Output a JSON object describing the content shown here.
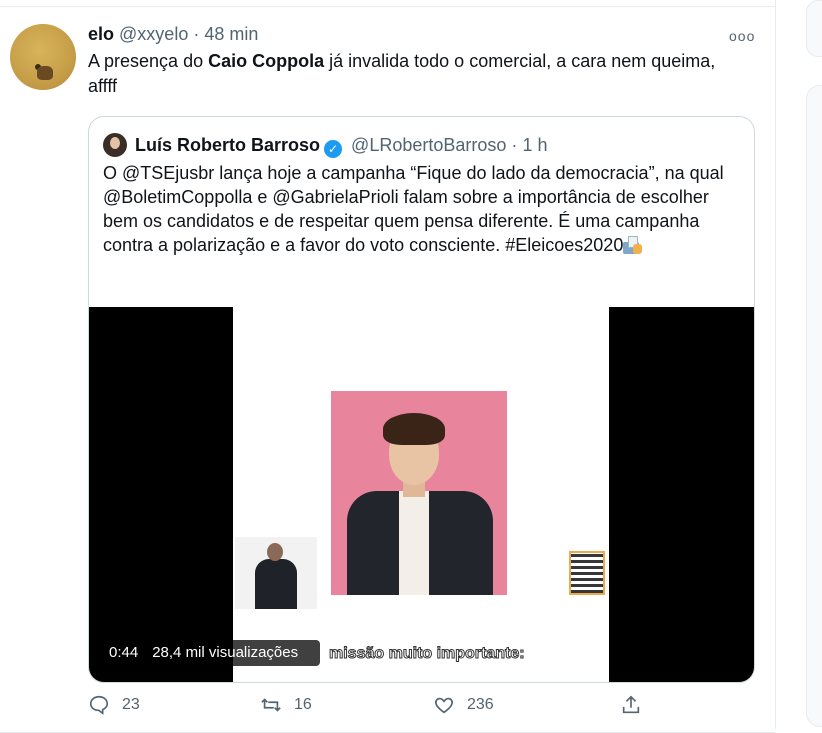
{
  "tweet": {
    "name": "elo",
    "handle": "@xxyelo",
    "separator": "·",
    "time": "48 min",
    "text_before": "A presença do ",
    "text_bold": "Caio Coppola",
    "text_after": " já invalida todo o comercial, a cara nem queima, affff",
    "more_label": "ooo"
  },
  "quote": {
    "name": "Luís Roberto Barroso",
    "verified_glyph": "✓",
    "handle": "@LRobertoBarroso",
    "separator": "·",
    "time": "1 h",
    "text": "O @TSEjusbr lança hoje a campanha “Fique do lado da democracia”, na qual @BoletimCoppolla e @GabrielaPrioli falam sobre a importância de escolher bem os candidatos e de respeitar quem pensa diferente. É uma campanha contra a polarização e a favor do voto consciente. #Eleicoes2020",
    "emoji": "ballot-box-icon"
  },
  "video": {
    "duration": "0:44",
    "views": "28,4 mil visualizações",
    "caption": "missão muito importante:"
  },
  "actions": {
    "reply_count": "23",
    "retweet_count": "16",
    "like_count": "236"
  }
}
